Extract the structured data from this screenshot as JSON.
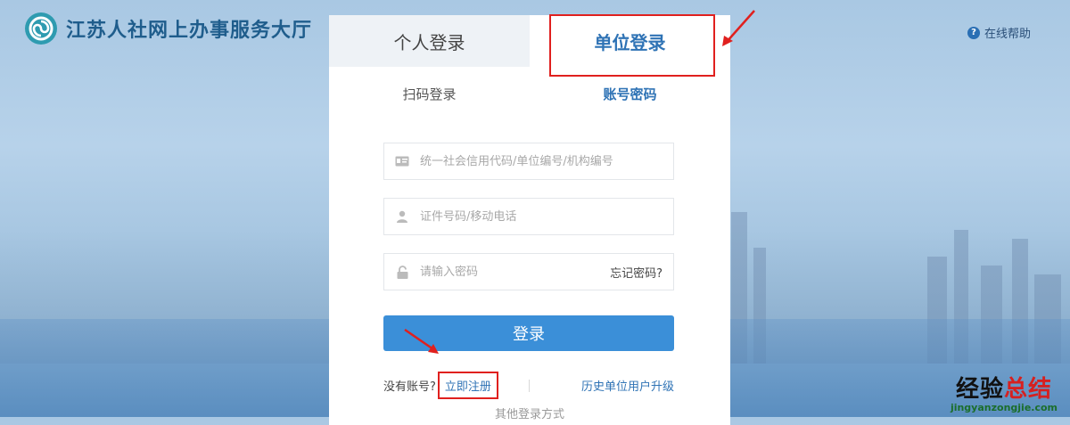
{
  "header": {
    "title": "江苏人社网上办事服务大厅",
    "help_label": "在线帮助"
  },
  "tabs": [
    {
      "label": "个人登录"
    },
    {
      "label": "单位登录"
    }
  ],
  "subtabs": [
    {
      "label": "扫码登录"
    },
    {
      "label": "账号密码"
    }
  ],
  "form": {
    "org_code_placeholder": "统一社会信用代码/单位编号/机构编号",
    "id_placeholder": "证件号码/移动电话",
    "password_placeholder": "请输入密码",
    "forgot_label": "忘记密码?",
    "login_label": "登录",
    "no_account_label": "没有账号?",
    "register_label": "立即注册",
    "upgrade_label": "历史单位用户升级",
    "other_label": "其他登录方式"
  },
  "watermark": {
    "text_black": "经验",
    "text_red": "总结",
    "url": "jingyanzongjie.com"
  },
  "colors": {
    "accent": "#2f73b5",
    "button": "#3b8fd8",
    "highlight": "#e0201e"
  }
}
